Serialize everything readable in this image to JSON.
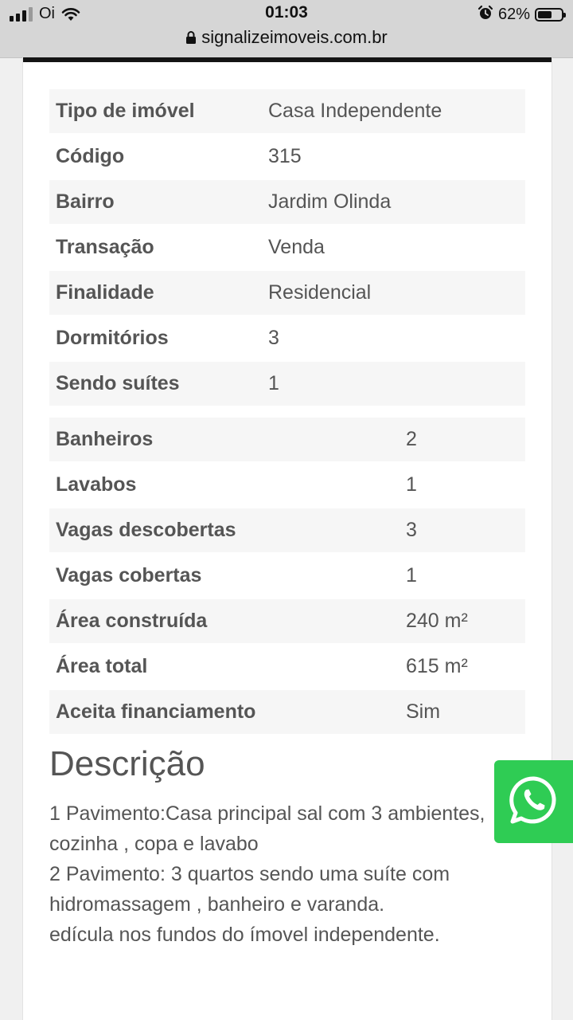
{
  "status_bar": {
    "carrier": "Oi",
    "time": "01:03",
    "battery": "62%",
    "battery_level": 0.62,
    "url": "signalizeimoveis.com.br",
    "icons": [
      "signal-icon",
      "wifi-icon",
      "alarm-icon",
      "battery-icon",
      "lock-icon"
    ]
  },
  "table1": [
    {
      "label": "Tipo de imóvel",
      "value": "Casa Independente"
    },
    {
      "label": "Código",
      "value": "315"
    },
    {
      "label": "Bairro",
      "value": "Jardim Olinda"
    },
    {
      "label": "Transação",
      "value": "Venda"
    },
    {
      "label": "Finalidade",
      "value": "Residencial"
    },
    {
      "label": "Dormitórios",
      "value": "3"
    },
    {
      "label": "Sendo suítes",
      "value": "1"
    }
  ],
  "table2": [
    {
      "label": "Banheiros",
      "value": "2"
    },
    {
      "label": "Lavabos",
      "value": "1"
    },
    {
      "label": "Vagas descobertas",
      "value": "3"
    },
    {
      "label": "Vagas cobertas",
      "value": "1"
    },
    {
      "label": "Área construída",
      "value": "240 m²"
    },
    {
      "label": "Área total",
      "value": "615 m²"
    },
    {
      "label": "Aceita financiamento",
      "value": "Sim"
    }
  ],
  "description": {
    "title": "Descrição",
    "lines": [
      "1 Pavimento:Casa principal sal com 3 ambientes,",
      "cozinha , copa e lavabo",
      "2 Pavimento: 3 quartos sendo uma suíte com",
      "hidromassagem , banheiro e varanda.",
      "edícula nos fundos do ímovel independente."
    ]
  },
  "whatsapp": {
    "icon": "whatsapp-icon",
    "color": "#2fcc54"
  }
}
